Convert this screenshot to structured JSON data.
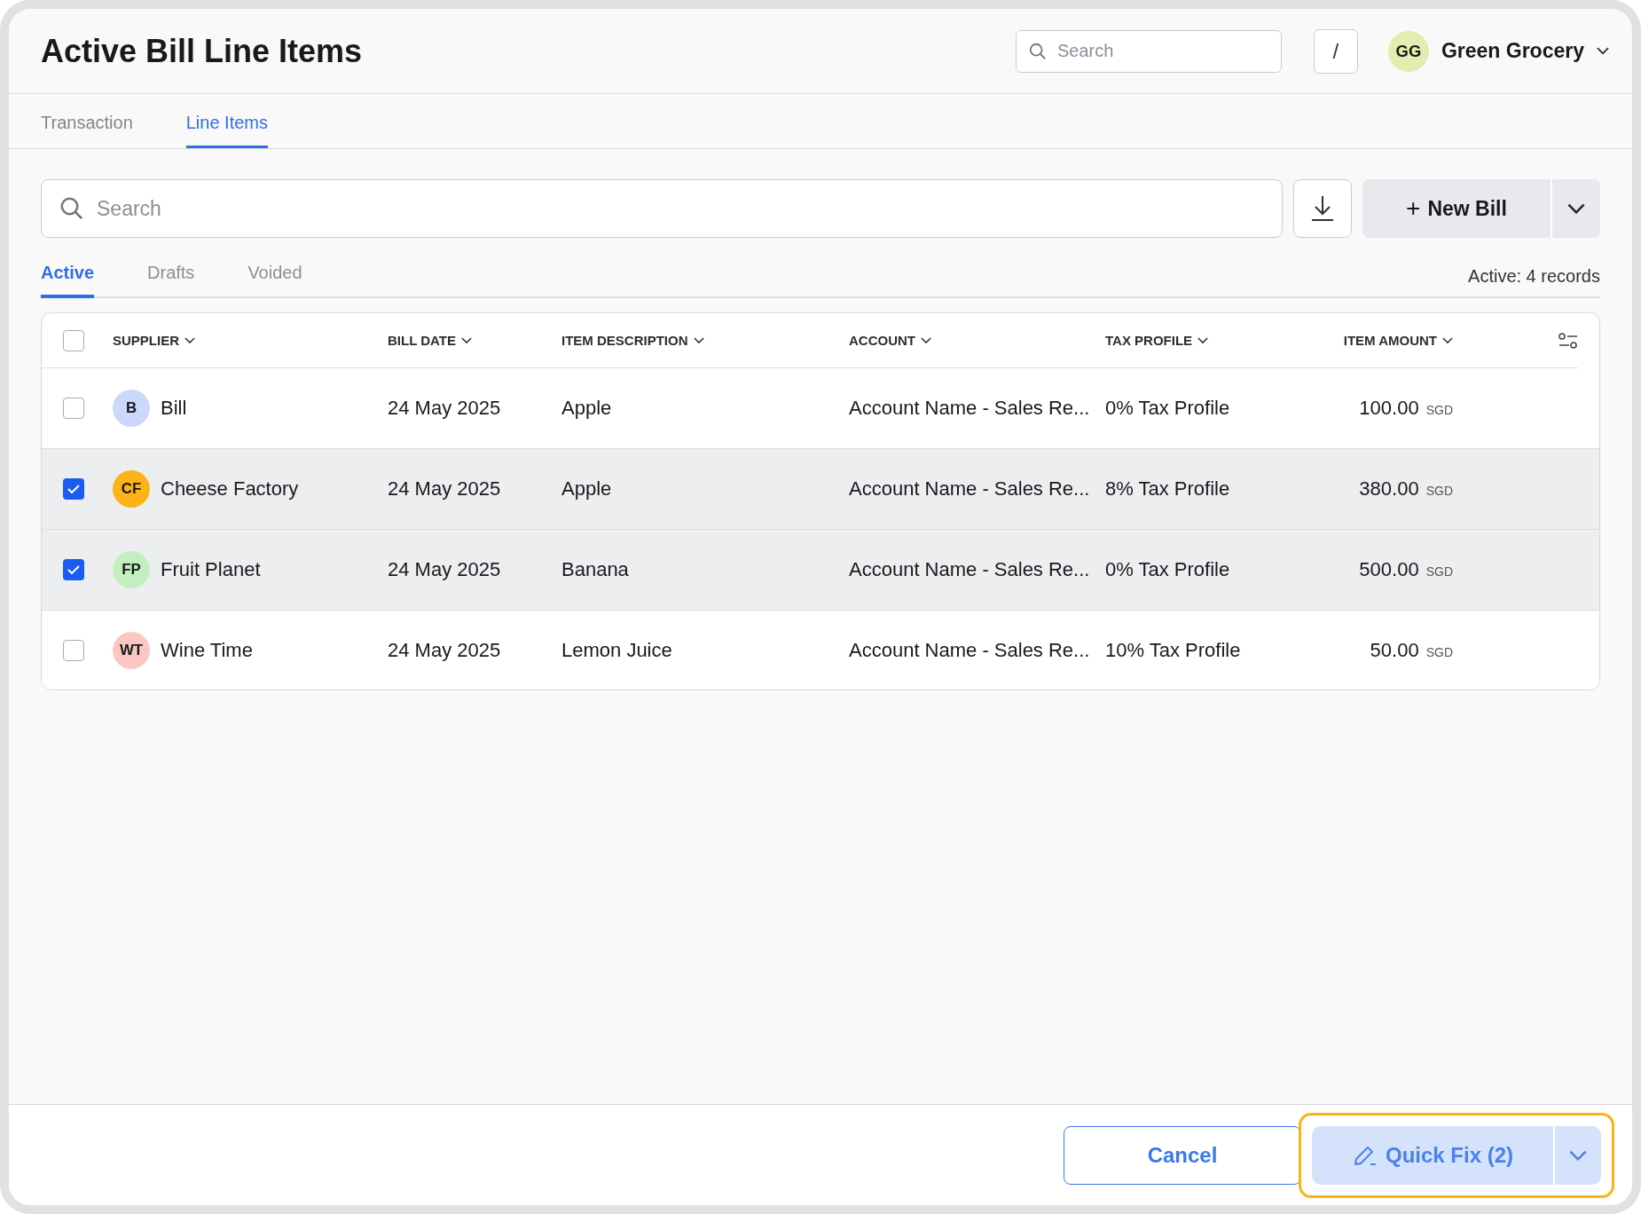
{
  "header": {
    "title": "Active Bill Line Items",
    "search": {
      "placeholder": "Search"
    },
    "shortcut_key": "/",
    "user": {
      "initials": "GG",
      "name": "Green Grocery"
    }
  },
  "tabs": [
    {
      "label": "Transaction",
      "selected": false
    },
    {
      "label": "Line Items",
      "selected": true
    }
  ],
  "toolbar": {
    "search": {
      "placeholder": "Search"
    },
    "new_bill": {
      "label": "New Bill",
      "icon": "+"
    }
  },
  "status_tabs": [
    {
      "label": "Active",
      "selected": true
    },
    {
      "label": "Drafts",
      "selected": false
    },
    {
      "label": "Voided",
      "selected": false
    }
  ],
  "record_count": "Active: 4 records",
  "table": {
    "all_checked": false,
    "columns": [
      "SUPPLIER",
      "BILL DATE",
      "ITEM DESCRIPTION",
      "ACCOUNT",
      "TAX PROFILE",
      "ITEM AMOUNT"
    ],
    "rows": [
      {
        "checked": false,
        "initials": "B",
        "color": "#c9d8fb",
        "supplier": "Bill",
        "date": "24 May 2025",
        "description": "Apple",
        "account": "Account Name - Sales Re...",
        "tax": "0% Tax Profile",
        "amount": "100.00",
        "currency": "SGD"
      },
      {
        "checked": true,
        "initials": "CF",
        "color": "#fcb316",
        "supplier": "Cheese Factory",
        "date": "24 May 2025",
        "description": "Apple",
        "account": "Account Name - Sales Re...",
        "tax": "8% Tax Profile",
        "amount": "380.00",
        "currency": "SGD"
      },
      {
        "checked": true,
        "initials": "FP",
        "color": "#c3efc0",
        "supplier": "Fruit Planet",
        "date": "24 May 2025",
        "description": "Banana",
        "account": "Account Name - Sales Re...",
        "tax": "0% Tax Profile",
        "amount": "500.00",
        "currency": "SGD"
      },
      {
        "checked": false,
        "initials": "WT",
        "color": "#fcc7c3",
        "supplier": "Wine Time",
        "date": "24 May 2025",
        "description": "Lemon Juice",
        "account": "Account Name - Sales Re...",
        "tax": "10% Tax Profile",
        "amount": "50.00",
        "currency": "SGD"
      }
    ]
  },
  "footer": {
    "cancel": "Cancel",
    "quick_fix": {
      "label": "Quick Fix (2)",
      "focused": true
    }
  }
}
